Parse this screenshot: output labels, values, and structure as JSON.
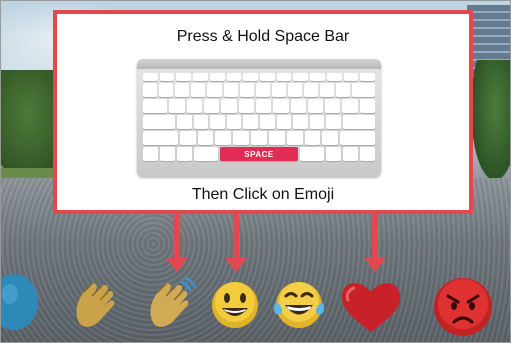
{
  "instruction": {
    "title": "Press & Hold Space Bar",
    "subtitle": "Then Click on Emoji",
    "space_key_label": "SPACE"
  },
  "colors": {
    "panel_border": "#e4484f",
    "arrow": "#e4484f",
    "space_key": "#e12c56"
  },
  "emoji_bar": [
    {
      "name": "blue-partial-icon"
    },
    {
      "name": "clapping-hands-icon"
    },
    {
      "name": "waving-hands-icon"
    },
    {
      "name": "grinning-face-icon"
    },
    {
      "name": "tears-of-joy-face-icon"
    },
    {
      "name": "red-heart-icon"
    },
    {
      "name": "angry-face-icon"
    }
  ]
}
